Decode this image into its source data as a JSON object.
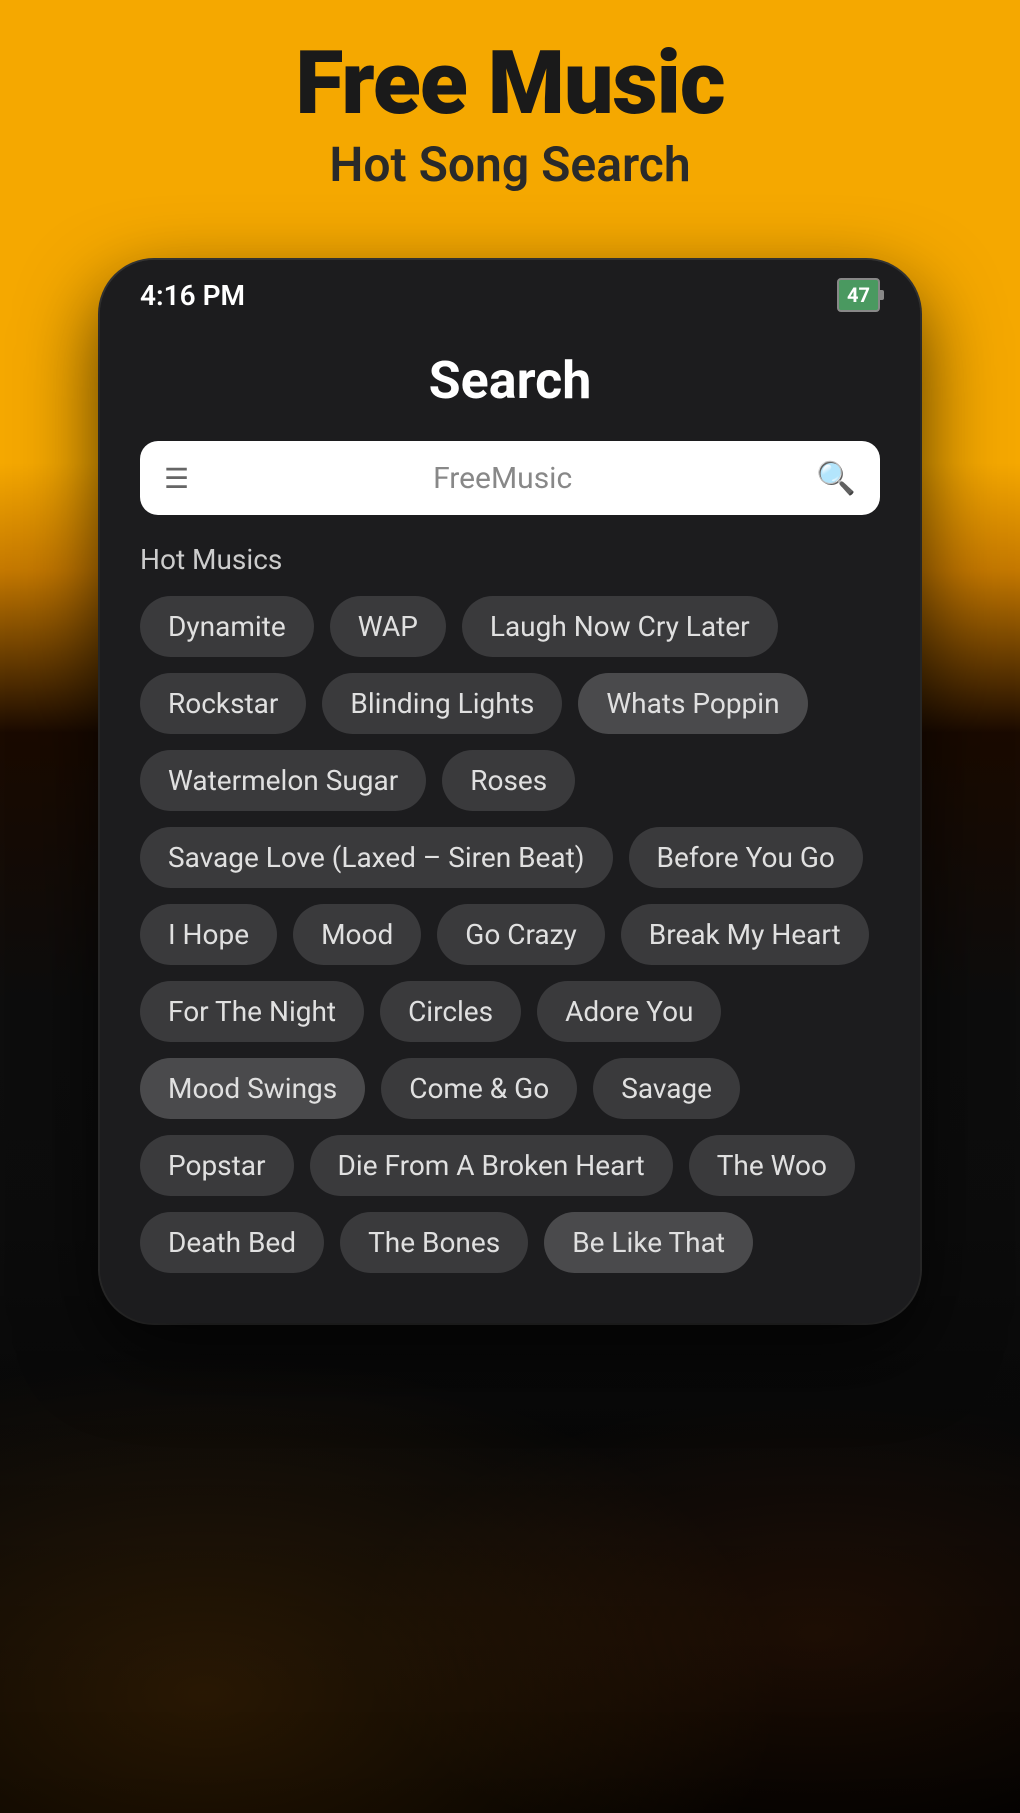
{
  "header": {
    "main_title": "Free Music",
    "sub_title": "Hot Song Search"
  },
  "status_bar": {
    "time": "4:16 PM",
    "battery": "47"
  },
  "phone": {
    "page_title": "Search",
    "search_placeholder": "FreeMusic",
    "hot_label": "Hot Musics"
  },
  "tags": [
    {
      "id": "dynamite",
      "label": "Dynamite",
      "highlighted": false
    },
    {
      "id": "wap",
      "label": "WAP",
      "highlighted": false
    },
    {
      "id": "laugh-now",
      "label": "Laugh Now Cry Later",
      "highlighted": false
    },
    {
      "id": "rockstar",
      "label": "Rockstar",
      "highlighted": false
    },
    {
      "id": "blinding-lights",
      "label": "Blinding Lights",
      "highlighted": false
    },
    {
      "id": "whats-poppin",
      "label": "Whats Poppin",
      "highlighted": true
    },
    {
      "id": "watermelon-sugar",
      "label": "Watermelon Sugar",
      "highlighted": false
    },
    {
      "id": "roses",
      "label": "Roses",
      "highlighted": false
    },
    {
      "id": "savage-love",
      "label": "Savage Love (Laxed – Siren Beat)",
      "highlighted": false
    },
    {
      "id": "before-you-go",
      "label": "Before You Go",
      "highlighted": false
    },
    {
      "id": "i-hope",
      "label": "I Hope",
      "highlighted": false
    },
    {
      "id": "mood",
      "label": "Mood",
      "highlighted": false
    },
    {
      "id": "go-crazy",
      "label": "Go Crazy",
      "highlighted": false
    },
    {
      "id": "break-my-heart",
      "label": "Break My Heart",
      "highlighted": false
    },
    {
      "id": "for-the-night",
      "label": "For The Night",
      "highlighted": false
    },
    {
      "id": "circles",
      "label": "Circles",
      "highlighted": false
    },
    {
      "id": "adore-you",
      "label": "Adore You",
      "highlighted": false
    },
    {
      "id": "mood-swings",
      "label": "Mood Swings",
      "highlighted": true
    },
    {
      "id": "come-go",
      "label": "Come & Go",
      "highlighted": false
    },
    {
      "id": "savage",
      "label": "Savage",
      "highlighted": false
    },
    {
      "id": "popstar",
      "label": "Popstar",
      "highlighted": false
    },
    {
      "id": "die-from",
      "label": "Die From A Broken Heart",
      "highlighted": false
    },
    {
      "id": "the-woo",
      "label": "The Woo",
      "highlighted": false
    },
    {
      "id": "death-bed",
      "label": "Death Bed",
      "highlighted": false
    },
    {
      "id": "the-bones",
      "label": "The Bones",
      "highlighted": false
    },
    {
      "id": "be-like-that",
      "label": "Be Like That",
      "highlighted": true
    }
  ]
}
